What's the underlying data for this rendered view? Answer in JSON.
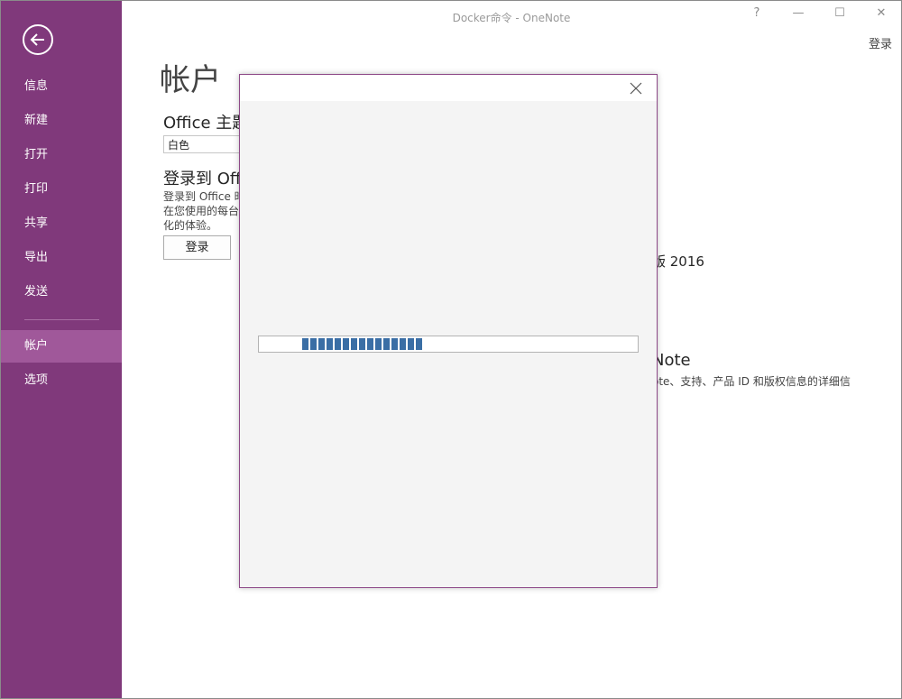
{
  "window": {
    "title": "Docker命令 - OneNote",
    "help": "?",
    "minimize": "—",
    "maximize": "☐",
    "close": "✕",
    "signin_link": "登录"
  },
  "sidebar": {
    "items": [
      {
        "label": "信息"
      },
      {
        "label": "新建"
      },
      {
        "label": "打开"
      },
      {
        "label": "打印"
      },
      {
        "label": "共享"
      },
      {
        "label": "导出"
      },
      {
        "label": "发送"
      },
      {
        "label": "帐户",
        "active": true
      },
      {
        "label": "选项"
      }
    ]
  },
  "main": {
    "title": "帐户",
    "theme_heading": "Office 主题",
    "theme_value": "白色",
    "signin_heading": "登录到 Office",
    "signin_desc_1": "登录到 Office 时",
    "signin_desc_2": "在您使用的每台设",
    "signin_desc_3": "化的体验。",
    "signin_button": "登录",
    "product_version_fragment": "版 2016",
    "about_heading_fragment": "Note",
    "about_desc_fragment": "ote、支持、产品 ID 和版权信息的详细信"
  },
  "dialog": {
    "progress_segments": 15
  },
  "colors": {
    "sidebar_bg": "#80397b",
    "sidebar_active": "#a0589a",
    "progress_fill": "#3a6ea5"
  }
}
